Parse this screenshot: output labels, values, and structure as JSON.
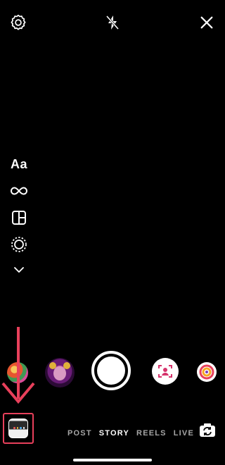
{
  "top_bar": {
    "settings_icon": "gear-icon",
    "flash_icon": "flash-off-icon",
    "close_icon": "close-icon"
  },
  "left_tools": [
    {
      "label": "Aa",
      "icon": "create-text"
    },
    {
      "icon": "infinity-boomerang-icon"
    },
    {
      "icon": "layout-icon"
    },
    {
      "icon": "hands-free-icon"
    },
    {
      "icon": "chevron-down-icon"
    }
  ],
  "effects": [
    {
      "icon": "effect-colorful"
    },
    {
      "icon": "effect-face-filter"
    },
    {
      "icon": "shutter"
    },
    {
      "icon": "effect-face-scan"
    },
    {
      "icon": "effect-ring"
    }
  ],
  "modes": [
    {
      "label": "POST",
      "active": false
    },
    {
      "label": "STORY",
      "active": true
    },
    {
      "label": "REELS",
      "active": false
    },
    {
      "label": "LIVE",
      "active": false
    }
  ],
  "colors": {
    "accent_red": "#e8405b",
    "inactive_mode": "#a6a6a6",
    "background": "#000000"
  }
}
